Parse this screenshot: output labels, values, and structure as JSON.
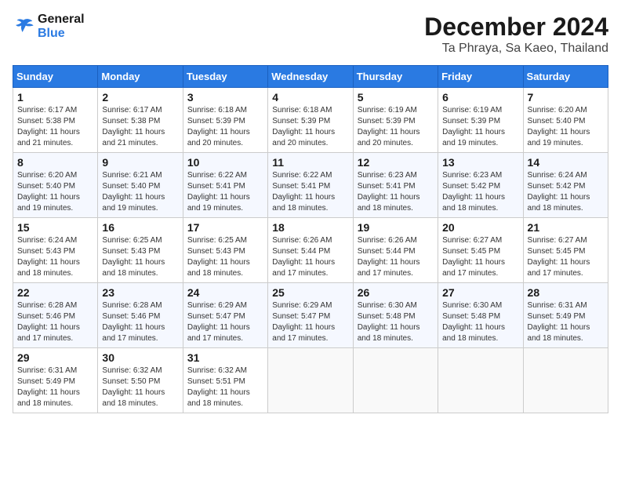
{
  "header": {
    "logo_line1": "General",
    "logo_line2": "Blue",
    "month": "December 2024",
    "location": "Ta Phraya, Sa Kaeo, Thailand"
  },
  "weekdays": [
    "Sunday",
    "Monday",
    "Tuesday",
    "Wednesday",
    "Thursday",
    "Friday",
    "Saturday"
  ],
  "weeks": [
    [
      {
        "day": "1",
        "sunrise": "6:17 AM",
        "sunset": "5:38 PM",
        "daylight": "11 hours and 21 minutes."
      },
      {
        "day": "2",
        "sunrise": "6:17 AM",
        "sunset": "5:38 PM",
        "daylight": "11 hours and 21 minutes."
      },
      {
        "day": "3",
        "sunrise": "6:18 AM",
        "sunset": "5:39 PM",
        "daylight": "11 hours and 20 minutes."
      },
      {
        "day": "4",
        "sunrise": "6:18 AM",
        "sunset": "5:39 PM",
        "daylight": "11 hours and 20 minutes."
      },
      {
        "day": "5",
        "sunrise": "6:19 AM",
        "sunset": "5:39 PM",
        "daylight": "11 hours and 20 minutes."
      },
      {
        "day": "6",
        "sunrise": "6:19 AM",
        "sunset": "5:39 PM",
        "daylight": "11 hours and 19 minutes."
      },
      {
        "day": "7",
        "sunrise": "6:20 AM",
        "sunset": "5:40 PM",
        "daylight": "11 hours and 19 minutes."
      }
    ],
    [
      {
        "day": "8",
        "sunrise": "6:20 AM",
        "sunset": "5:40 PM",
        "daylight": "11 hours and 19 minutes."
      },
      {
        "day": "9",
        "sunrise": "6:21 AM",
        "sunset": "5:40 PM",
        "daylight": "11 hours and 19 minutes."
      },
      {
        "day": "10",
        "sunrise": "6:22 AM",
        "sunset": "5:41 PM",
        "daylight": "11 hours and 19 minutes."
      },
      {
        "day": "11",
        "sunrise": "6:22 AM",
        "sunset": "5:41 PM",
        "daylight": "11 hours and 18 minutes."
      },
      {
        "day": "12",
        "sunrise": "6:23 AM",
        "sunset": "5:41 PM",
        "daylight": "11 hours and 18 minutes."
      },
      {
        "day": "13",
        "sunrise": "6:23 AM",
        "sunset": "5:42 PM",
        "daylight": "11 hours and 18 minutes."
      },
      {
        "day": "14",
        "sunrise": "6:24 AM",
        "sunset": "5:42 PM",
        "daylight": "11 hours and 18 minutes."
      }
    ],
    [
      {
        "day": "15",
        "sunrise": "6:24 AM",
        "sunset": "5:43 PM",
        "daylight": "11 hours and 18 minutes."
      },
      {
        "day": "16",
        "sunrise": "6:25 AM",
        "sunset": "5:43 PM",
        "daylight": "11 hours and 18 minutes."
      },
      {
        "day": "17",
        "sunrise": "6:25 AM",
        "sunset": "5:43 PM",
        "daylight": "11 hours and 18 minutes."
      },
      {
        "day": "18",
        "sunrise": "6:26 AM",
        "sunset": "5:44 PM",
        "daylight": "11 hours and 17 minutes."
      },
      {
        "day": "19",
        "sunrise": "6:26 AM",
        "sunset": "5:44 PM",
        "daylight": "11 hours and 17 minutes."
      },
      {
        "day": "20",
        "sunrise": "6:27 AM",
        "sunset": "5:45 PM",
        "daylight": "11 hours and 17 minutes."
      },
      {
        "day": "21",
        "sunrise": "6:27 AM",
        "sunset": "5:45 PM",
        "daylight": "11 hours and 17 minutes."
      }
    ],
    [
      {
        "day": "22",
        "sunrise": "6:28 AM",
        "sunset": "5:46 PM",
        "daylight": "11 hours and 17 minutes."
      },
      {
        "day": "23",
        "sunrise": "6:28 AM",
        "sunset": "5:46 PM",
        "daylight": "11 hours and 17 minutes."
      },
      {
        "day": "24",
        "sunrise": "6:29 AM",
        "sunset": "5:47 PM",
        "daylight": "11 hours and 17 minutes."
      },
      {
        "day": "25",
        "sunrise": "6:29 AM",
        "sunset": "5:47 PM",
        "daylight": "11 hours and 17 minutes."
      },
      {
        "day": "26",
        "sunrise": "6:30 AM",
        "sunset": "5:48 PM",
        "daylight": "11 hours and 18 minutes."
      },
      {
        "day": "27",
        "sunrise": "6:30 AM",
        "sunset": "5:48 PM",
        "daylight": "11 hours and 18 minutes."
      },
      {
        "day": "28",
        "sunrise": "6:31 AM",
        "sunset": "5:49 PM",
        "daylight": "11 hours and 18 minutes."
      }
    ],
    [
      {
        "day": "29",
        "sunrise": "6:31 AM",
        "sunset": "5:49 PM",
        "daylight": "11 hours and 18 minutes."
      },
      {
        "day": "30",
        "sunrise": "6:32 AM",
        "sunset": "5:50 PM",
        "daylight": "11 hours and 18 minutes."
      },
      {
        "day": "31",
        "sunrise": "6:32 AM",
        "sunset": "5:51 PM",
        "daylight": "11 hours and 18 minutes."
      },
      null,
      null,
      null,
      null
    ]
  ],
  "labels": {
    "sunrise": "Sunrise:",
    "sunset": "Sunset:",
    "daylight": "Daylight:"
  }
}
